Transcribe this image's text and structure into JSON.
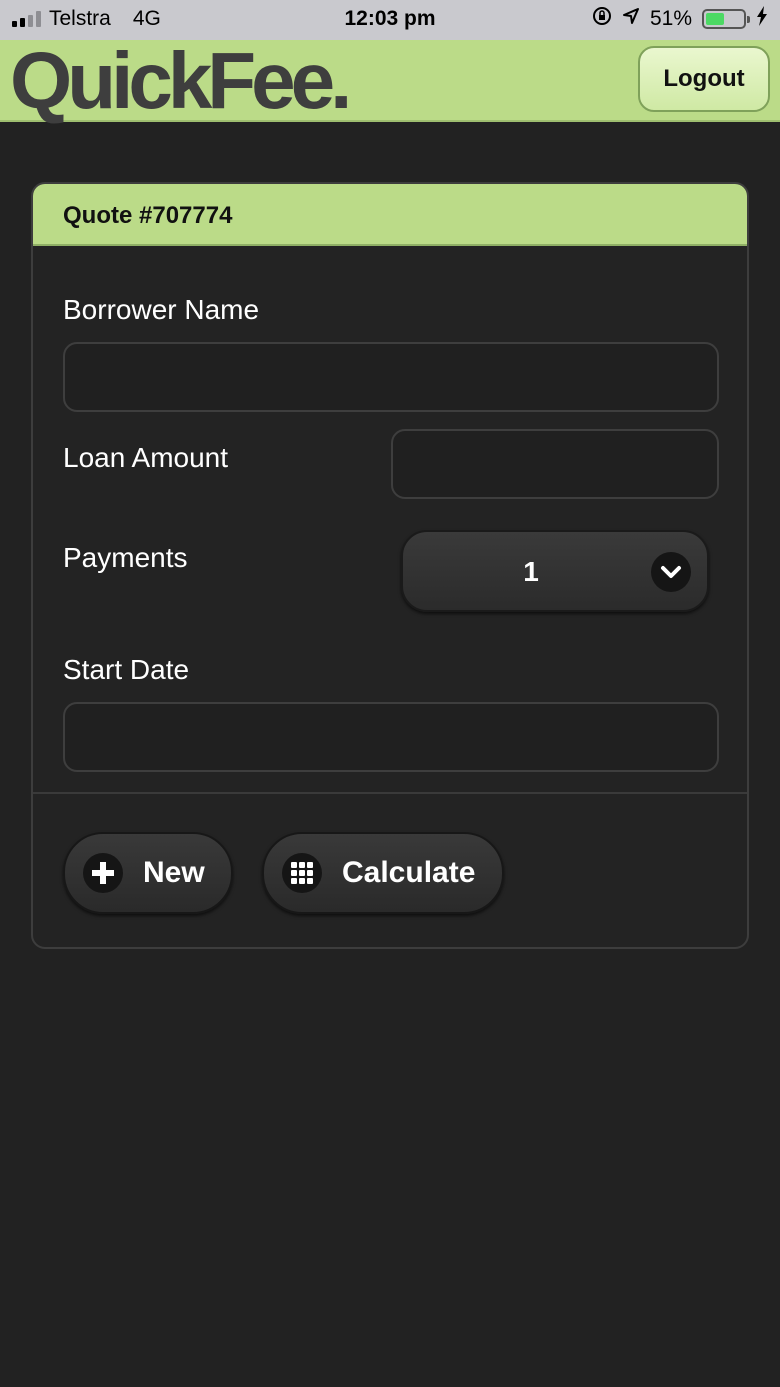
{
  "status_bar": {
    "carrier": "Telstra",
    "network": "4G",
    "time": "12:03 pm",
    "battery_percent_text": "51%",
    "battery_level": 0.51
  },
  "header": {
    "logo": "QuickFee.",
    "logout_label": "Logout"
  },
  "quote": {
    "title": "Quote #707774",
    "fields": {
      "borrower_name": {
        "label": "Borrower Name",
        "value": ""
      },
      "loan_amount": {
        "label": "Loan Amount",
        "value": ""
      },
      "payments": {
        "label": "Payments",
        "value": "1"
      },
      "start_date": {
        "label": "Start Date",
        "value": ""
      }
    },
    "buttons": {
      "new_label": "New",
      "calculate_label": "Calculate"
    }
  },
  "colors": {
    "accent_green": "#bbdb88",
    "background": "#222222"
  }
}
